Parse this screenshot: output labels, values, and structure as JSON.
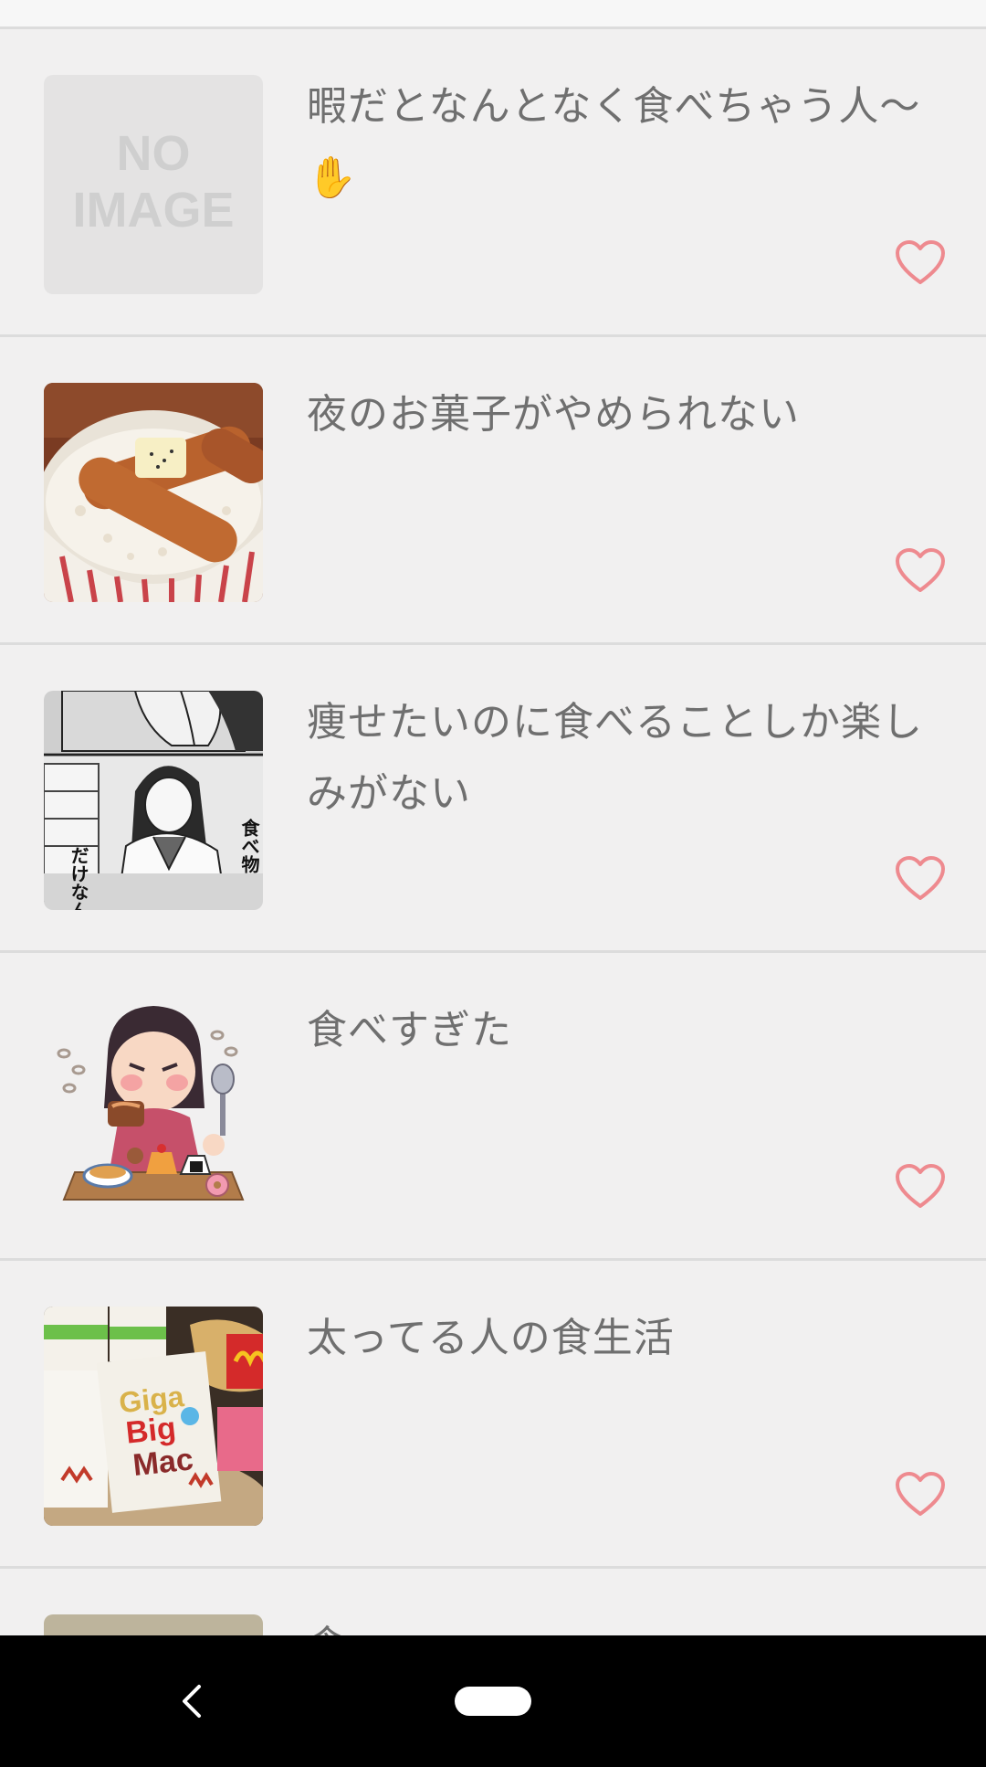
{
  "colors": {
    "background": "#f1f0f0",
    "title_text": "#6f6f6f",
    "divider": "#dcdcdc",
    "heart": "#ee8a8f",
    "nav_bar": "#000000"
  },
  "list": {
    "items": [
      {
        "title": "暇だとなんとなく食べちゃう人〜✋",
        "image": "no-image-placeholder",
        "placeholder_text_1": "NO",
        "placeholder_text_2": "IMAGE",
        "favorite_icon": "heart-outline-icon"
      },
      {
        "title": "夜のお菓子がやめられない",
        "image": "sausage-rice-bowl-photo",
        "favorite_icon": "heart-outline-icon"
      },
      {
        "title": "痩せたいのに食べることしか楽しみがない",
        "image": "manga-panel-girl-eating",
        "manga_text_1": "食べ物",
        "manga_text_2": "だけなん",
        "favorite_icon": "heart-outline-icon"
      },
      {
        "title": "食べすぎた",
        "image": "overeating-girl-illustration",
        "favorite_icon": "heart-outline-icon"
      },
      {
        "title": "太ってる人の食生活",
        "image": "fast-food-boxes-photo",
        "box_text_1": "Giga",
        "box_text_2": "Big",
        "box_text_3": "Mac",
        "favorite_icon": "heart-outline-icon"
      }
    ],
    "peek_title": "食"
  },
  "nav": {
    "back_icon": "chevron-left-icon",
    "home_icon": "home-pill-icon"
  }
}
